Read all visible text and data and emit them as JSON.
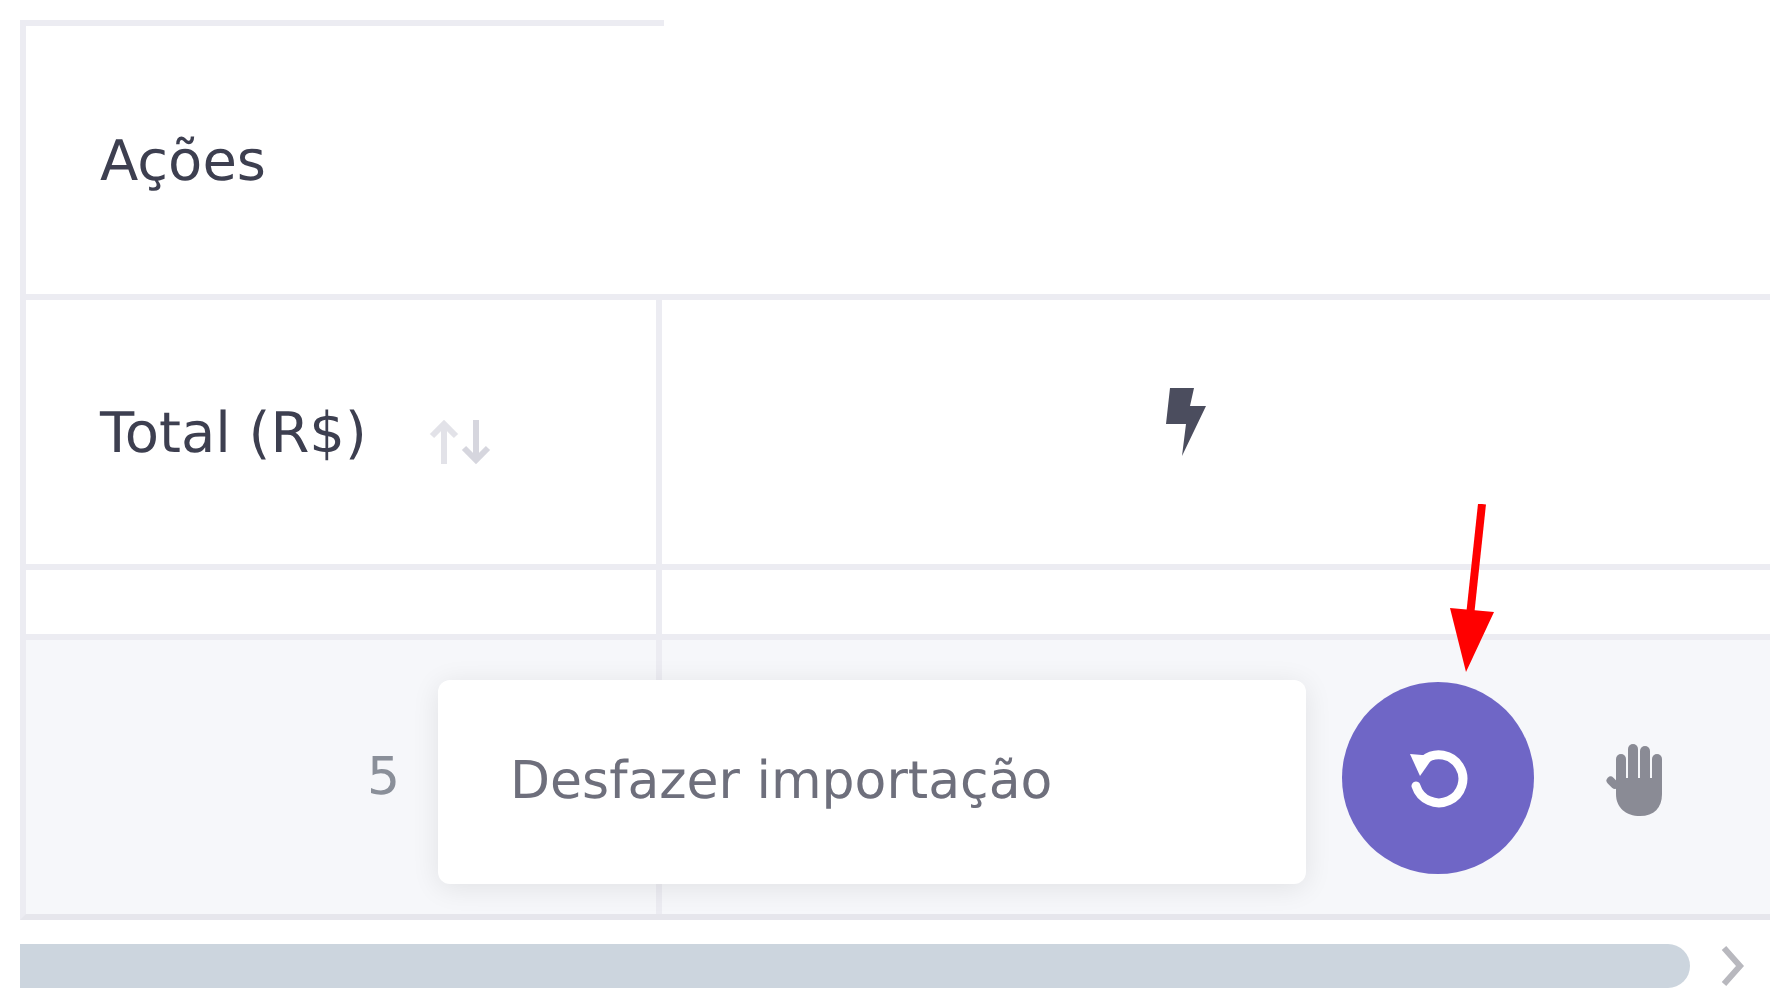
{
  "table": {
    "group_header": "Ações",
    "columns": [
      {
        "kind": "text",
        "label": "Total (R$)",
        "sortable": true
      },
      {
        "kind": "icon"
      }
    ],
    "rows": [
      {
        "total": "5"
      }
    ]
  },
  "tooltip": {
    "text": "Desfazer importação"
  }
}
